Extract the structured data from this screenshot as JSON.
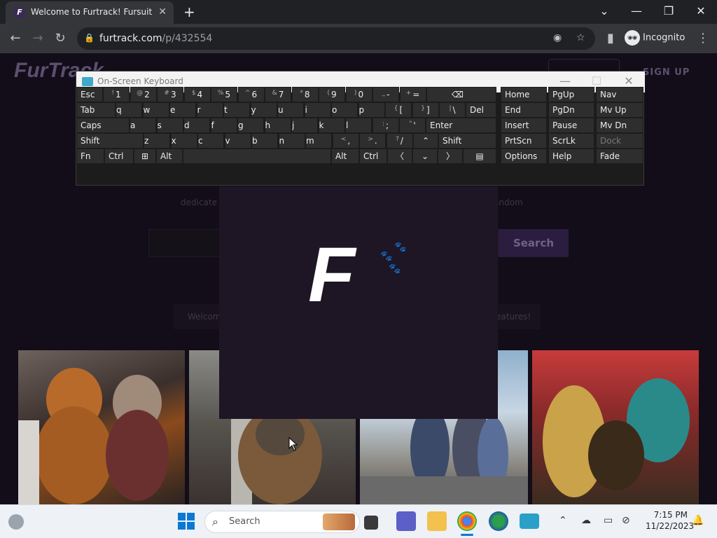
{
  "browser": {
    "tab_title": "Welcome to Furtrack! Fursuit ph",
    "tab_favicon_letter": "F",
    "url_domain": "furtrack.com",
    "url_path": "/p/432554",
    "incognito_label": "Incognito"
  },
  "site": {
    "logo": "FurTrack",
    "signup": "SIGN UP",
    "tagline_left": "dedicate",
    "tagline_right": "y fandom",
    "search_button": "Search",
    "welcome_left": "Welcom",
    "welcome_right": "eatures!",
    "loading_logo": "F"
  },
  "osk": {
    "title": "On-Screen Keyboard",
    "rows": [
      [
        "Esc",
        "1",
        "2",
        "3",
        "4",
        "5",
        "6",
        "7",
        "8",
        "9",
        "0",
        "-",
        "="
      ],
      [
        "Tab",
        "q",
        "w",
        "e",
        "r",
        "t",
        "y",
        "u",
        "i",
        "o",
        "p",
        "[",
        "]",
        "\\",
        "Del"
      ],
      [
        "Caps",
        "a",
        "s",
        "d",
        "f",
        "g",
        "h",
        "j",
        "k",
        "l",
        ";",
        "'",
        "Enter"
      ],
      [
        "Shift",
        "z",
        "x",
        "c",
        "v",
        "b",
        "n",
        "m",
        ",",
        ".",
        "/",
        "Shift"
      ],
      [
        "Fn",
        "Ctrl",
        "Alt",
        "Alt",
        "Ctrl"
      ]
    ],
    "shift_glyphs": {
      "1": "!",
      "2": "@",
      "3": "#",
      "4": "$",
      "5": "%",
      "6": "^",
      "7": "&",
      "8": "*",
      "9": "(",
      "0": ")",
      "-": "_",
      "=": "+",
      "[": "{",
      "]": "}",
      "\\": "|",
      ";": ":",
      "'": "\"",
      ",": "<",
      ".": ">",
      "/": "?"
    },
    "nav_keys": [
      [
        "Home",
        "PgUp",
        "Nav"
      ],
      [
        "End",
        "PgDn",
        "Mv Up"
      ],
      [
        "Insert",
        "Pause",
        "Mv Dn"
      ],
      [
        "PrtScn",
        "ScrLk",
        "Dock"
      ],
      [
        "Options",
        "Help",
        "Fade"
      ]
    ]
  },
  "taskbar": {
    "search_label": "Search",
    "time": "7:15 PM",
    "date": "11/22/2023"
  },
  "colors": {
    "browser_bg": "#202124",
    "page_bg": "#120d18",
    "osk_key": "#2e2e2e",
    "accent": "#2b1d3f"
  }
}
